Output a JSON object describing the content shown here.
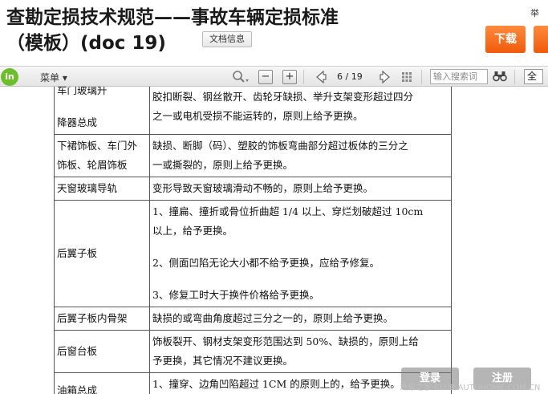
{
  "header": {
    "title_line1": "查勘定损技术规范——事故车辆定损标准",
    "title_line2": "（模板）(doc 19)",
    "docinfo_label": "文档信息",
    "top_right_char": "举",
    "download_label": "下载"
  },
  "toolbar": {
    "logo_text": "in",
    "menu_label": "菜单",
    "page_current": "6",
    "page_separator": "/",
    "page_total": "19",
    "search_placeholder": "输入搜索词",
    "right_char": "全"
  },
  "table": {
    "rows": [
      {
        "part": [
          "车门玻璃升",
          "",
          "降器总成"
        ],
        "remedy": [
          "胶扣断裂、钢丝散开、齿轮牙缺损、举升支架变形超过四分",
          "之一或电机受损不能运转的，原则上给予更换。"
        ]
      },
      {
        "part": [
          "下裙饰板、车门外",
          "饰板、轮眉饰板"
        ],
        "remedy": [
          "缺损、断脚（码）、塑胶的饰板弯曲部分超过板体的三分之",
          "一或撕裂的，原则上给予更换。"
        ]
      },
      {
        "part": [
          "天窗玻璃导轨"
        ],
        "remedy": [
          "变形导致天窗玻璃滑动不畅的，原则上给予更换。"
        ]
      },
      {
        "part": [
          "后翼子板"
        ],
        "remedy": [
          "1、撞扁、撞折或骨位折曲超 1/4 以上、穿烂划破超过 10cm",
          "以上，给予更换。",
          "",
          "2、侧面凹陷无论大小都不给予更换，应给予修复。",
          "",
          "3、修复工时大于换件价格给予更换。"
        ]
      },
      {
        "part": [
          "后翼子板内骨架"
        ],
        "remedy": [
          "缺损的或弯曲角度超过三分之一的，原则上给予更换。"
        ]
      },
      {
        "part": [
          "后窗台板"
        ],
        "remedy": [
          "饰板裂开、钢材支架变形范围达到 50%、缺损的，原则上给",
          "予更换，其它情况不建议更换。"
        ]
      },
      {
        "part": [
          "油箱总成"
        ],
        "remedy": [
          "1、撞穿、边角凹陷超过 1CM 的原则上的，给予更换。",
          ""
        ]
      }
    ]
  },
  "overlay": {
    "login_label": "登录",
    "register_label": "注册",
    "watermark": "汽车之家 CLUB.AUTOHOME.COM.CN"
  }
}
